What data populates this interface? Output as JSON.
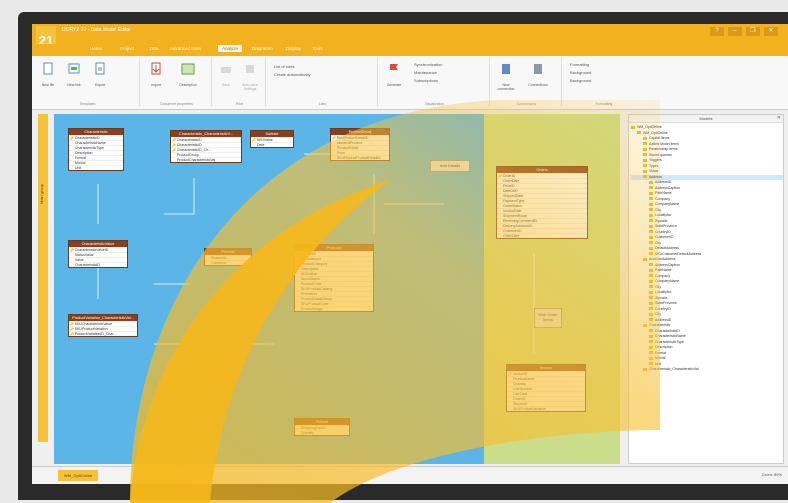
{
  "app": {
    "logo_text": "21",
    "title": "DORYZ 21 - Data Model Editor",
    "user": "",
    "controls": [
      "?",
      "–",
      "❐",
      "✕"
    ]
  },
  "menu_tabs": [
    "Home",
    "Project",
    "DDL",
    "Advanced tools",
    "Analyze",
    "Diagramm",
    "Display",
    "Tools"
  ],
  "ribbon_groups": [
    {
      "label": "Templates",
      "buttons": [
        "New file",
        "New link",
        "Export"
      ]
    },
    {
      "label": "Document properties",
      "buttons": [
        "Import",
        "Description"
      ]
    },
    {
      "label": "Print",
      "buttons": [
        "Save",
        "Auto save Settings"
      ]
    },
    {
      "label": "Lists",
      "buttons": [
        "List of roles",
        "Create automatically"
      ]
    },
    {
      "label": "Visualization",
      "buttons": [
        "Generate",
        "Synchronization",
        "Maintenance",
        "Subscriptions"
      ]
    },
    {
      "label": "Connections",
      "buttons": [
        "New connection",
        "Connections"
      ]
    },
    {
      "label": "Formatting",
      "buttons": [
        "Formatting",
        "Background",
        "Background"
      ]
    }
  ],
  "left_strip_label": "Main group",
  "entities": [
    {
      "title": "Characteristic",
      "rows": [
        "CharacteristicID",
        "CharacteristicName",
        "CharacteristicType",
        "Description",
        "Format",
        "MinVal",
        "Unit"
      ]
    },
    {
      "title": "Characteristic_CharacteristicV...",
      "rows": [
        "CharacteristicID",
        "CharacteristicID",
        "CharacteristicID_Ch...",
        "ProductGroup",
        "ProductCharacteristicVal"
      ]
    },
    {
      "title": "Sortiate",
      "rows": [
        "SKUValue",
        "Date"
      ]
    },
    {
      "title": "ProductDetail",
      "rows": [
        "SKUProductDetailID",
        "NameOfProduct",
        "ProductDetail",
        "Price",
        "SKUProductProductDetailID"
      ]
    },
    {
      "title": "Orders",
      "rows": [
        "OrderID",
        "OrderDate",
        "PriceID",
        "DateOfID",
        "ShippedDate",
        "PaymentType",
        "OrderStatus",
        "InvoiceDate",
        "ShipmentRoute",
        "ReceivingCommentID",
        "DeliveryAddressID",
        "CustomerID",
        "OrderDate"
      ]
    },
    {
      "title": "CharacteristicValue",
      "rows": [
        "CharacteristicValueID",
        "StatusValue",
        "Value",
        "CharacteristicID"
      ]
    },
    {
      "title": "Pricelist",
      "rows": [
        "ReasonID",
        "Comment"
      ]
    },
    {
      "title": "Products",
      "rows": [
        "ProductID",
        "Discontinued",
        "ProductCategory",
        "Description",
        "SKUValue",
        "StockStatus",
        "ProductCode",
        "SKUProductCatalog",
        "Promotion",
        "ProductDetailGroup",
        "SKUProductCode",
        "ProductImage"
      ]
    },
    {
      "title": "ProductVariation_CharacteristicVal...",
      "rows": [
        "SKUCharacteristicValue",
        "SKUProductVariation",
        "ProductVariationID_Char..."
      ]
    },
    {
      "title": "Invoice",
      "rows": [
        "InvoiceID",
        "ProductName",
        "Quantity",
        "LineNumber",
        "LineTotal",
        "OrderID",
        "Discount",
        "SKUProductVariation"
      ]
    },
    {
      "title": "Fullcart",
      "rows": [
        "ShoppingCartID",
        "Quantity"
      ]
    }
  ],
  "notes": [
    "Add Details",
    "Web Order Items"
  ],
  "sidebar": {
    "title": "Models",
    "close": "✕",
    "items": [
      "WM_OptiOnline",
      "WM_OptiOnline",
      "Capital Items",
      "Added Model items",
      "Relationship items",
      "Stored queries",
      "Triggers",
      "Types",
      "Views",
      "Address",
      "AddressID",
      "AddressCaption",
      "PathName",
      "Company",
      "CompanyName",
      "City",
      "LocalityNo",
      "Zipcode",
      "StateProvince",
      "CountryID",
      "CustomerID",
      "City",
      "DefaultAddress",
      "SKUCustomerDefaultAddress",
      "ArchivedAddress",
      "AddressCaption",
      "PathName",
      "Company",
      "CompanyName",
      "City",
      "LocalityNo",
      "Zipcode",
      "StateProvince",
      "CountryID",
      "City",
      "AddressID",
      "Characteristic",
      "CharacteristicID",
      "CharacteristicName",
      "CharacteristicType",
      "Description",
      "Format",
      "MinVal",
      "Unit",
      "Characteristic_CharacteristicVal"
    ]
  },
  "statusbar": {
    "doc_tab": "WM_OptiOnline",
    "zoom": "Zoom: 89%"
  }
}
